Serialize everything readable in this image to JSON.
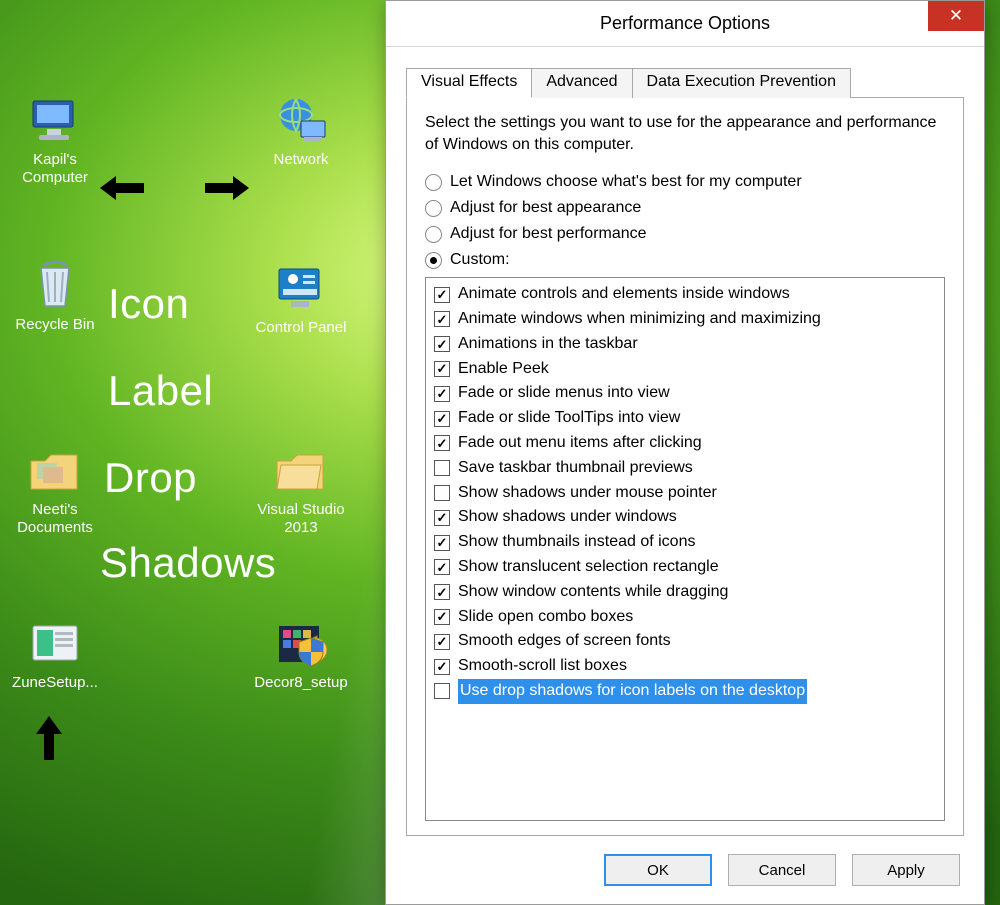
{
  "desktop": {
    "icons": [
      {
        "id": "kapils-computer",
        "label": "Kapil's Computer"
      },
      {
        "id": "network",
        "label": "Network"
      },
      {
        "id": "recycle-bin",
        "label": "Recycle Bin"
      },
      {
        "id": "control-panel",
        "label": "Control Panel"
      },
      {
        "id": "neetis-documents",
        "label": "Neeti's Documents"
      },
      {
        "id": "visual-studio-2013",
        "label": "Visual Studio 2013"
      },
      {
        "id": "zunesetup",
        "label": "ZuneSetup..."
      },
      {
        "id": "decor8-setup",
        "label": "Decor8_setup"
      }
    ],
    "annotation": {
      "l1": "Icon",
      "l2": "Label",
      "l3": "Drop",
      "l4": "Shadows"
    }
  },
  "dialog": {
    "title": "Performance Options",
    "close_glyph": "✕",
    "tabs": [
      {
        "label": "Visual Effects",
        "active": true
      },
      {
        "label": "Advanced",
        "active": false
      },
      {
        "label": "Data Execution Prevention",
        "active": false
      }
    ],
    "description": "Select the settings you want to use for the appearance and performance of Windows on this computer.",
    "radios": [
      {
        "label": "Let Windows choose what's best for my computer",
        "selected": false
      },
      {
        "label": "Adjust for best appearance",
        "selected": false
      },
      {
        "label": "Adjust for best performance",
        "selected": false
      },
      {
        "label": "Custom:",
        "selected": true
      }
    ],
    "options": [
      {
        "label": "Animate controls and elements inside windows",
        "checked": true,
        "selected": false
      },
      {
        "label": "Animate windows when minimizing and maximizing",
        "checked": true,
        "selected": false
      },
      {
        "label": "Animations in the taskbar",
        "checked": true,
        "selected": false
      },
      {
        "label": "Enable Peek",
        "checked": true,
        "selected": false
      },
      {
        "label": "Fade or slide menus into view",
        "checked": true,
        "selected": false
      },
      {
        "label": "Fade or slide ToolTips into view",
        "checked": true,
        "selected": false
      },
      {
        "label": "Fade out menu items after clicking",
        "checked": true,
        "selected": false
      },
      {
        "label": "Save taskbar thumbnail previews",
        "checked": false,
        "selected": false
      },
      {
        "label": "Show shadows under mouse pointer",
        "checked": false,
        "selected": false
      },
      {
        "label": "Show shadows under windows",
        "checked": true,
        "selected": false
      },
      {
        "label": "Show thumbnails instead of icons",
        "checked": true,
        "selected": false
      },
      {
        "label": "Show translucent selection rectangle",
        "checked": true,
        "selected": false
      },
      {
        "label": "Show window contents while dragging",
        "checked": true,
        "selected": false
      },
      {
        "label": "Slide open combo boxes",
        "checked": true,
        "selected": false
      },
      {
        "label": "Smooth edges of screen fonts",
        "checked": true,
        "selected": false
      },
      {
        "label": "Smooth-scroll list boxes",
        "checked": true,
        "selected": false
      },
      {
        "label": "Use drop shadows for icon labels on the desktop",
        "checked": false,
        "selected": true
      }
    ],
    "buttons": {
      "ok": "OK",
      "cancel": "Cancel",
      "apply": "Apply"
    }
  }
}
